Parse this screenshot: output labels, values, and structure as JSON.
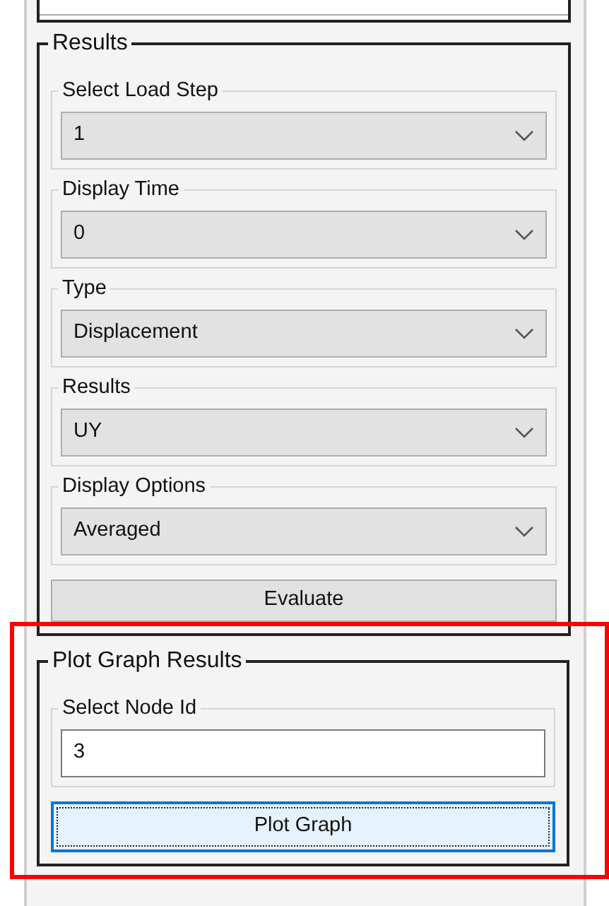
{
  "groups": [
    {
      "title": "Results",
      "highlighted": false,
      "fields": [
        {
          "kind": "dropdown",
          "label": "Select Load Step",
          "value": "1"
        },
        {
          "kind": "dropdown",
          "label": "Display Time",
          "value": "0"
        },
        {
          "kind": "dropdown",
          "label": "Type",
          "value": "Displacement"
        },
        {
          "kind": "dropdown",
          "label": "Results",
          "value": "UY"
        },
        {
          "kind": "dropdown",
          "label": "Display Options",
          "value": "Averaged"
        }
      ],
      "button": {
        "label": "Evaluate",
        "focused": false
      }
    },
    {
      "title": "Plot Graph Results",
      "highlighted": true,
      "fields": [
        {
          "kind": "text",
          "label": "Select Node Id",
          "value": "3"
        }
      ],
      "button": {
        "label": "Plot Graph",
        "focused": true
      }
    }
  ]
}
